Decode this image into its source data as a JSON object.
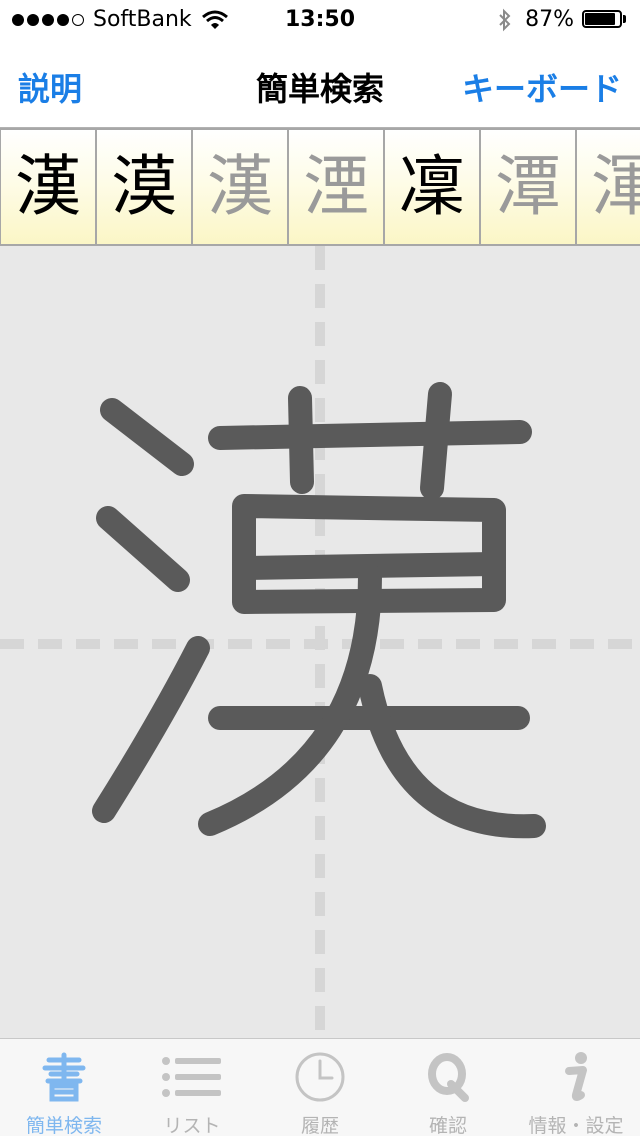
{
  "status_bar": {
    "carrier": "SoftBank",
    "time": "13:50",
    "battery_text": "87%",
    "battery_level": 0.87
  },
  "nav": {
    "left_button": "説明",
    "title": "簡単検索",
    "right_button": "キーボード"
  },
  "candidates": [
    {
      "char": "漢",
      "state": "primary"
    },
    {
      "char": "漠",
      "state": "primary"
    },
    {
      "char": "漢",
      "state": "dim"
    },
    {
      "char": "湮",
      "state": "dim"
    },
    {
      "char": "凜",
      "state": "primary"
    },
    {
      "char": "潭",
      "state": "dim"
    },
    {
      "char": "渾",
      "state": "dim"
    }
  ],
  "tabs": [
    {
      "label": "簡単検索",
      "icon": "brush-kanji-icon",
      "active": true
    },
    {
      "label": "リスト",
      "icon": "list-icon",
      "active": false
    },
    {
      "label": "履歴",
      "icon": "clock-icon",
      "active": false
    },
    {
      "label": "確認",
      "icon": "q-icon",
      "active": false
    },
    {
      "label": "情報・設定",
      "icon": "info-icon",
      "active": false
    }
  ],
  "colors": {
    "accent": "#1a7ee6",
    "tab_active": "#7fb7ef",
    "tab_inactive": "#b4b4b4",
    "ink": "#5a5a5a",
    "canvas": "#e8e8e8",
    "guide": "#d6d6d6"
  }
}
